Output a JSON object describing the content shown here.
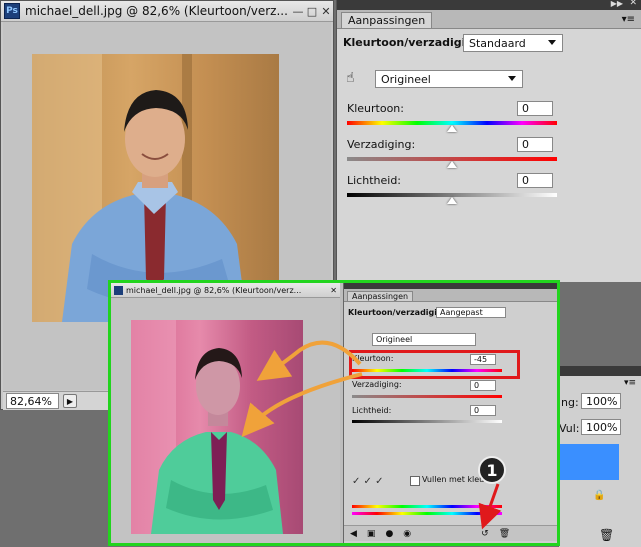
{
  "doc": {
    "title": "michael_dell.jpg @ 82,6% (Kleurtoon/verz...",
    "zoom": "82,64%"
  },
  "panel": {
    "tab": "Aanpassingen",
    "adjustment_title": "Kleurtoon/verzadiging",
    "preset_value": "Standaard",
    "channel_value": "Origineel",
    "hue_label": "Kleurtoon:",
    "hue_value": "0",
    "sat_label": "Verzadiging:",
    "sat_value": "0",
    "light_label": "Lichtheid:",
    "light_value": "0"
  },
  "layers": {
    "opacity_label": "ng:",
    "opacity_value": "100%",
    "fill_label": "Vul:",
    "fill_value": "100%"
  },
  "inset": {
    "doc_title": "michael_dell.jpg @ 82,6% (Kleurtoon/verz...",
    "tab": "Aanpassingen",
    "adjustment_title": "Kleurtoon/verzadiging",
    "preset_value": "Aangepast",
    "channel_value": "Origineel",
    "hue_label": "Kleurtoon:",
    "hue_value": "-45",
    "sat_label": "Verzadiging:",
    "sat_value": "0",
    "light_label": "Lichtheid:",
    "light_value": "0",
    "colorize_label": "Vullen met kleur",
    "callout_number": "1"
  },
  "colors": {
    "highlight_green": "#22d41e",
    "highlight_red": "#e0191b",
    "arrow_orange": "#f0a23a",
    "layer_selection": "#3a8fff"
  }
}
